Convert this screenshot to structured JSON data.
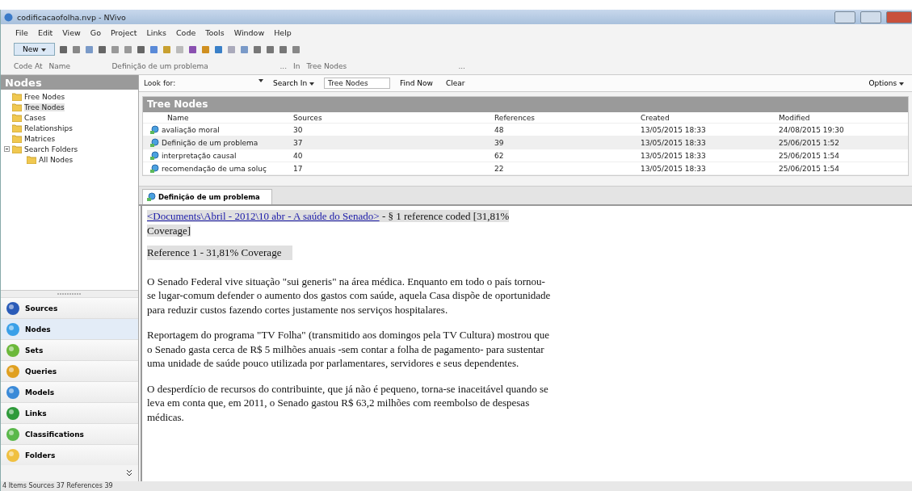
{
  "window": {
    "title": "codificacaofolha.nvp - NVivo"
  },
  "menu": [
    "File",
    "Edit",
    "View",
    "Go",
    "Project",
    "Links",
    "Code",
    "Tools",
    "Window",
    "Help"
  ],
  "toolbar": {
    "new_button": "New"
  },
  "code_bar": {
    "label": "Code At",
    "field_1": "Name",
    "field_2": "Definição de um problema",
    "more_1": "...",
    "in_label": "In",
    "field_3": "Tree Nodes",
    "more_2": "..."
  },
  "sidebar": {
    "title": "Nodes",
    "tree": [
      {
        "label": "Free Nodes",
        "selected": false
      },
      {
        "label": "Tree Nodes",
        "selected": true
      },
      {
        "label": "Cases",
        "selected": false
      },
      {
        "label": "Relationships",
        "selected": false
      },
      {
        "label": "Matrices",
        "selected": false
      },
      {
        "label": "Search Folders",
        "selected": false,
        "expanded": true,
        "children": [
          {
            "label": "All Nodes",
            "selected": false
          }
        ]
      }
    ],
    "nav": [
      {
        "label": "Sources",
        "selected": false
      },
      {
        "label": "Nodes",
        "selected": true
      },
      {
        "label": "Sets",
        "selected": false
      },
      {
        "label": "Queries",
        "selected": false
      },
      {
        "label": "Models",
        "selected": false
      },
      {
        "label": "Links",
        "selected": false
      },
      {
        "label": "Classifications",
        "selected": false
      },
      {
        "label": "Folders",
        "selected": false
      }
    ]
  },
  "find_bar": {
    "look_for": "Look for:",
    "search_in": "Search In",
    "search_scope": "Tree Nodes",
    "find_now": "Find Now",
    "clear": "Clear",
    "options": "Options"
  },
  "table": {
    "title": "Tree Nodes",
    "columns": [
      "Name",
      "Sources",
      "References",
      "Created",
      "Modified"
    ],
    "rows": [
      {
        "selected": false,
        "cells": [
          "avaliação moral",
          "30",
          "48",
          "13/05/2015 18:33",
          "24/08/2015 19:30"
        ]
      },
      {
        "selected": true,
        "cells": [
          "Definição de um problema",
          "37",
          "39",
          "13/05/2015 18:33",
          "25/06/2015 1:52"
        ]
      },
      {
        "selected": false,
        "cells": [
          "interpretação causal",
          "40",
          "62",
          "13/05/2015 18:33",
          "25/06/2015 1:54"
        ]
      },
      {
        "selected": false,
        "cells": [
          "recomendação de uma soluç",
          "17",
          "22",
          "13/05/2015 18:33",
          "25/06/2015 1:54"
        ]
      }
    ]
  },
  "detail": {
    "tab": "Definição de um problema",
    "source_link": "<Documents\\Abril - 2012\\10 abr - A saúde do Senado>",
    "source_info": " - § 1 reference coded  [31,81% Coverage]",
    "reference": "Reference 1 - 31,81% Coverage",
    "paragraphs": [
      "O Senado Federal vive situação \"sui generis\" na área médica. Enquanto em todo o país tornou-se lugar-comum defender o aumento dos gastos com saúde, aquela Casa dispõe de oportunidade para reduzir custos fazendo cortes justamente nos serviços hospitalares.",
      "Reportagem do programa \"TV Folha\" (transmitido aos domingos pela TV Cultura) mostrou que o Senado gasta cerca de R$ 5 milhões anuais -sem contar a folha de pagamento- para sustentar uma unidade de saúde pouco utilizada por parlamentares, servidores e seus dependentes.",
      "O desperdício de recursos do contribuinte, que já não é pequeno, torna-se inaceitável quando se leva em conta que, em 2011, o Senado gastou R$ 63,2 milhões com reembolso de despesas médicas."
    ]
  },
  "status_bar": "4 Items   Sources 37   References 39"
}
